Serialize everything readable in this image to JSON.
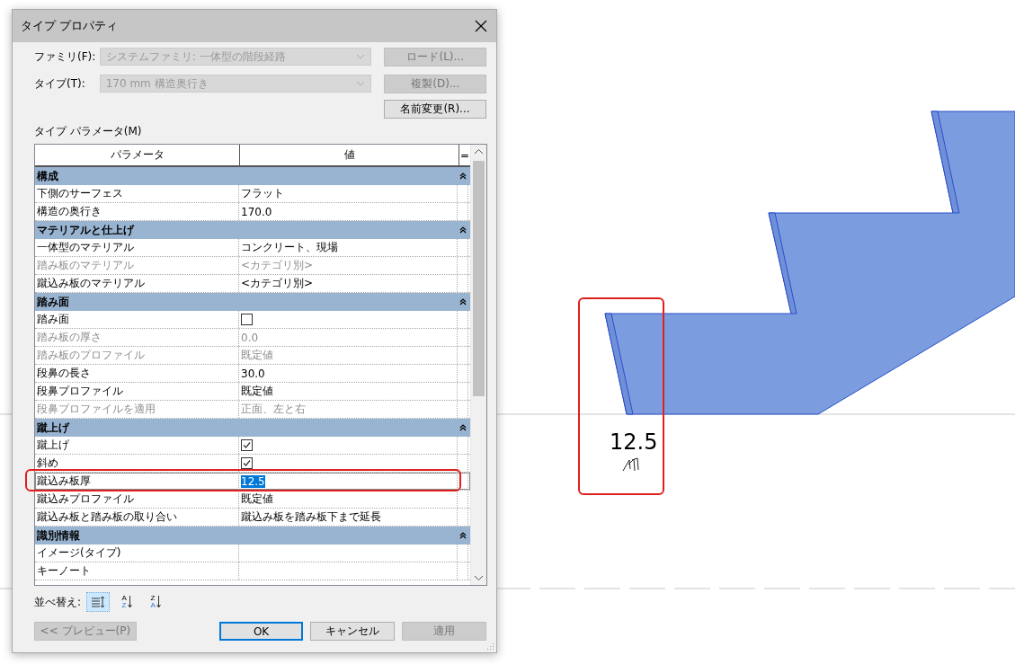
{
  "window": {
    "title": "タイプ プロパティ"
  },
  "fields": [
    {
      "label": "ファミリ(F):",
      "value": "システムファミリ: 一体型の階段経路",
      "disabled": true,
      "button": {
        "label": "ロード(L)...",
        "disabled": true
      }
    },
    {
      "label": "タイプ(T):",
      "value": "170 mm 構造奥行き",
      "disabled": true,
      "button": {
        "label": "複製(D)...",
        "disabled": true
      }
    }
  ],
  "rename_button": {
    "label": "名前変更(R)...",
    "disabled": false
  },
  "parameters_label": "タイプ パラメータ(M)",
  "table": {
    "columns": [
      "パラメータ",
      "値",
      "="
    ],
    "groups": [
      {
        "title": "構成",
        "rows": [
          {
            "name": "下側のサーフェス",
            "kind": "text",
            "value": "フラット",
            "disabled": false,
            "selected": false
          },
          {
            "name": "構造の奥行き",
            "kind": "text",
            "value": "170.0",
            "disabled": false,
            "selected": false
          }
        ]
      },
      {
        "title": "マテリアルと仕上げ",
        "rows": [
          {
            "name": "一体型のマテリアル",
            "kind": "text",
            "value": "コンクリート、現場",
            "disabled": false,
            "selected": false
          },
          {
            "name": "踏み板のマテリアル",
            "kind": "text",
            "value": "<カテゴリ別>",
            "disabled": true,
            "selected": false
          },
          {
            "name": "蹴込み板のマテリアル",
            "kind": "text",
            "value": "<カテゴリ別>",
            "disabled": false,
            "selected": false
          }
        ]
      },
      {
        "title": "踏み面",
        "rows": [
          {
            "name": "踏み面",
            "kind": "checkbox",
            "checked": false,
            "disabled": false,
            "selected": false
          },
          {
            "name": "踏み板の厚さ",
            "kind": "text",
            "value": "0.0",
            "disabled": true,
            "selected": false
          },
          {
            "name": "踏み板のプロファイル",
            "kind": "text",
            "value": "既定値",
            "disabled": true,
            "selected": false
          },
          {
            "name": "段鼻の長さ",
            "kind": "text",
            "value": "30.0",
            "disabled": false,
            "selected": false
          },
          {
            "name": "段鼻プロファイル",
            "kind": "text",
            "value": "既定値",
            "disabled": false,
            "selected": false
          },
          {
            "name": "段鼻プロファイルを適用",
            "kind": "text",
            "value": "正面、左と右",
            "disabled": true,
            "selected": false
          }
        ]
      },
      {
        "title": "蹴上げ",
        "rows": [
          {
            "name": "蹴上げ",
            "kind": "checkbox",
            "checked": true,
            "disabled": false,
            "selected": false
          },
          {
            "name": "斜め",
            "kind": "checkbox",
            "checked": true,
            "disabled": false,
            "selected": false
          },
          {
            "name": "蹴込み板厚",
            "kind": "text",
            "value": "12.5",
            "disabled": false,
            "selected": true
          },
          {
            "name": "蹴込みプロファイル",
            "kind": "text",
            "value": "既定値",
            "disabled": false,
            "selected": false
          },
          {
            "name": "蹴込み板と踏み板の取り合い",
            "kind": "text",
            "value": "蹴込み板を踏み板下まで延長",
            "disabled": false,
            "selected": false
          }
        ]
      },
      {
        "title": "識別情報",
        "rows": [
          {
            "name": "イメージ(タイプ)",
            "kind": "text",
            "disabled": false,
            "selected": false
          },
          {
            "name": "キーノート",
            "kind": "text",
            "disabled": false,
            "selected": false
          }
        ]
      }
    ]
  },
  "sort": {
    "label": "並べ替え:",
    "buttons": [
      {
        "kind": "category",
        "selected": true
      },
      {
        "kind": "ascending",
        "letters": [
          "A",
          "Z"
        ],
        "selected": false
      },
      {
        "kind": "descending",
        "letters": [
          "Z",
          "A"
        ],
        "selected": false
      }
    ]
  },
  "buttons": [
    {
      "label": "<< プレビュー(P)",
      "kind": "preview",
      "disabled": true
    },
    {
      "label": "OK",
      "kind": "default",
      "disabled": false
    },
    {
      "label": "キャンセル",
      "kind": "normal",
      "disabled": false
    },
    {
      "label": "適用",
      "kind": "normal",
      "disabled": true
    }
  ],
  "annotation": {
    "value": "12.5"
  }
}
